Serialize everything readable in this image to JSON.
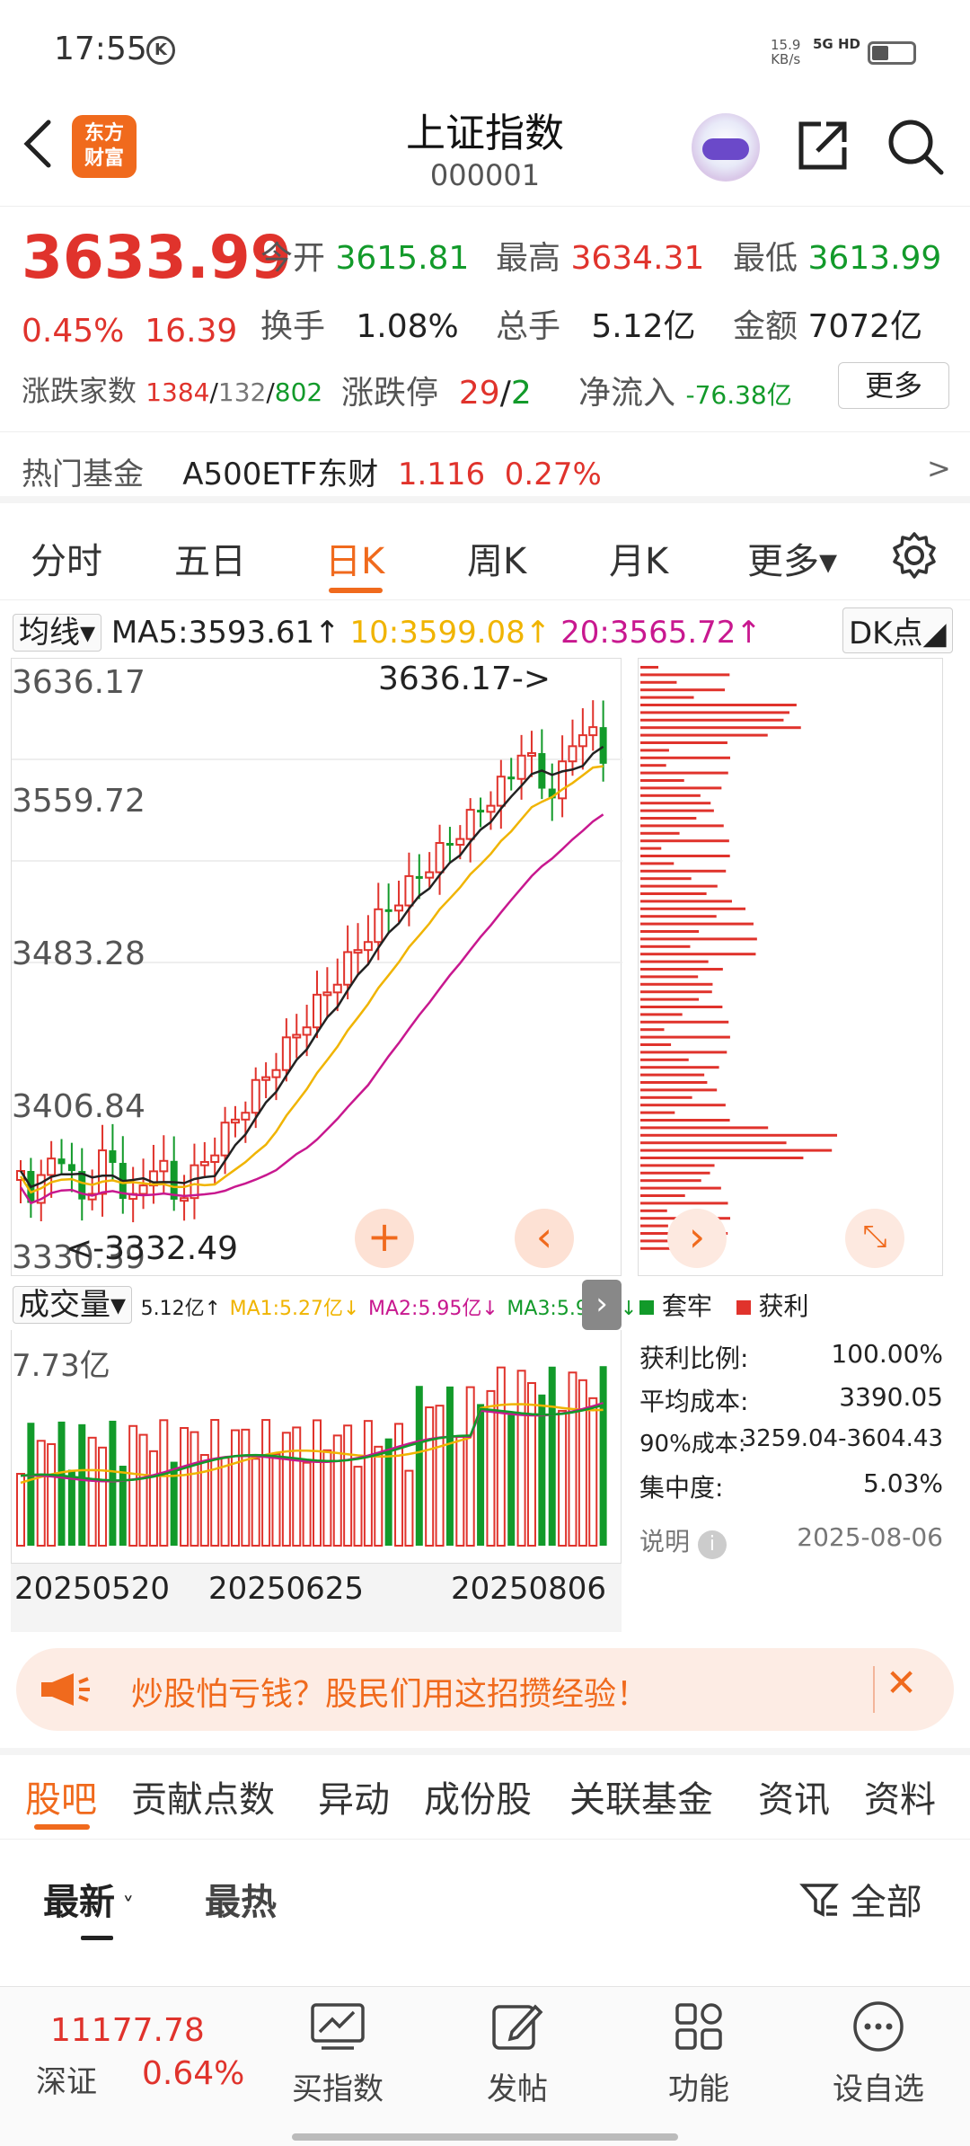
{
  "status": {
    "time": "17:55",
    "k_icon": "Ⓚ",
    "net_speed": "15.9",
    "net_unit": "KB/s",
    "signal": "5G HD"
  },
  "header": {
    "title": "上证指数",
    "code": "000001",
    "logo": [
      "东方",
      "财富"
    ]
  },
  "quote": {
    "price": "3633.99",
    "change_pct": "0.45%",
    "change": "16.39",
    "open_label": "今开",
    "open": "3615.81",
    "high_label": "最高",
    "high": "3634.31",
    "low_label": "最低",
    "low": "3613.99",
    "turnover_label": "换手",
    "turnover": "1.08%",
    "volume_label": "总手",
    "volume": "5.12亿",
    "amount_label": "金额",
    "amount": "7072亿",
    "breadth_label": "涨跌家数",
    "up": "1384",
    "flat": "132",
    "down": "802",
    "limit_label": "涨跌停",
    "limit_up": "29",
    "limit_down": "2",
    "netflow_label": "净流入",
    "netflow": "-76.38亿",
    "more": "更多"
  },
  "fund": {
    "label": "热门基金",
    "name": "A500ETF东财",
    "price": "1.116",
    "pct": "0.27%",
    "arrow": ">"
  },
  "tabs": [
    "分时",
    "五日",
    "日K",
    "周K",
    "月K",
    "更多▾"
  ],
  "ma": {
    "btn": "均线▾",
    "ma5": "MA5:3593.61↑",
    "ma10": "10:3599.08↑",
    "ma20": "20:3565.72↑",
    "dk": "DK点◢"
  },
  "chart_data": {
    "type": "candlestick",
    "y_ticks": [
      "3636.17",
      "3559.72",
      "3483.28",
      "3406.84",
      "3330.39"
    ],
    "ylim": [
      3330.39,
      3636.17
    ],
    "high_label": "3636.17->",
    "low_label": "<-3332.49",
    "volume": {
      "label": "成交量▾",
      "vol": "5.12亿↑",
      "ma1": "MA1:5.27亿↓",
      "ma2": "MA2:5.95亿↓",
      "ma3": "MA3:5.94亿↓",
      "max": "7.73亿"
    },
    "x_labels": [
      "20250520",
      "20250625",
      "20250806"
    ]
  },
  "chip": {
    "legend_trap": "套牢",
    "legend_profit": "获利",
    "rows": [
      {
        "k": "获利比例:",
        "v": "100.00%"
      },
      {
        "k": "平均成本:",
        "v": "3390.05"
      },
      {
        "k": "90%成本:",
        "v": "3259.04-3604.43"
      },
      {
        "k": "集中度:",
        "v": "5.03%"
      }
    ],
    "note": "说明",
    "date": "2025-08-06"
  },
  "banner": {
    "text": "炒股怕亏钱？股民们用这招攒经验！",
    "close": "✕"
  },
  "btabs": [
    "股吧",
    "贡献点数",
    "异动",
    "成份股",
    "关联基金",
    "资讯",
    "资料"
  ],
  "sub": {
    "latest": "最新",
    "hot": "最热",
    "filter": "全部"
  },
  "bottom": {
    "index_value": "11177.78",
    "index_name": "深证",
    "index_pct": "0.64%",
    "items": [
      "买指数",
      "发帖",
      "功能",
      "设自选"
    ]
  },
  "colors": {
    "up": "#e0332c",
    "down": "#129a2a",
    "accent": "#f06a1d"
  }
}
